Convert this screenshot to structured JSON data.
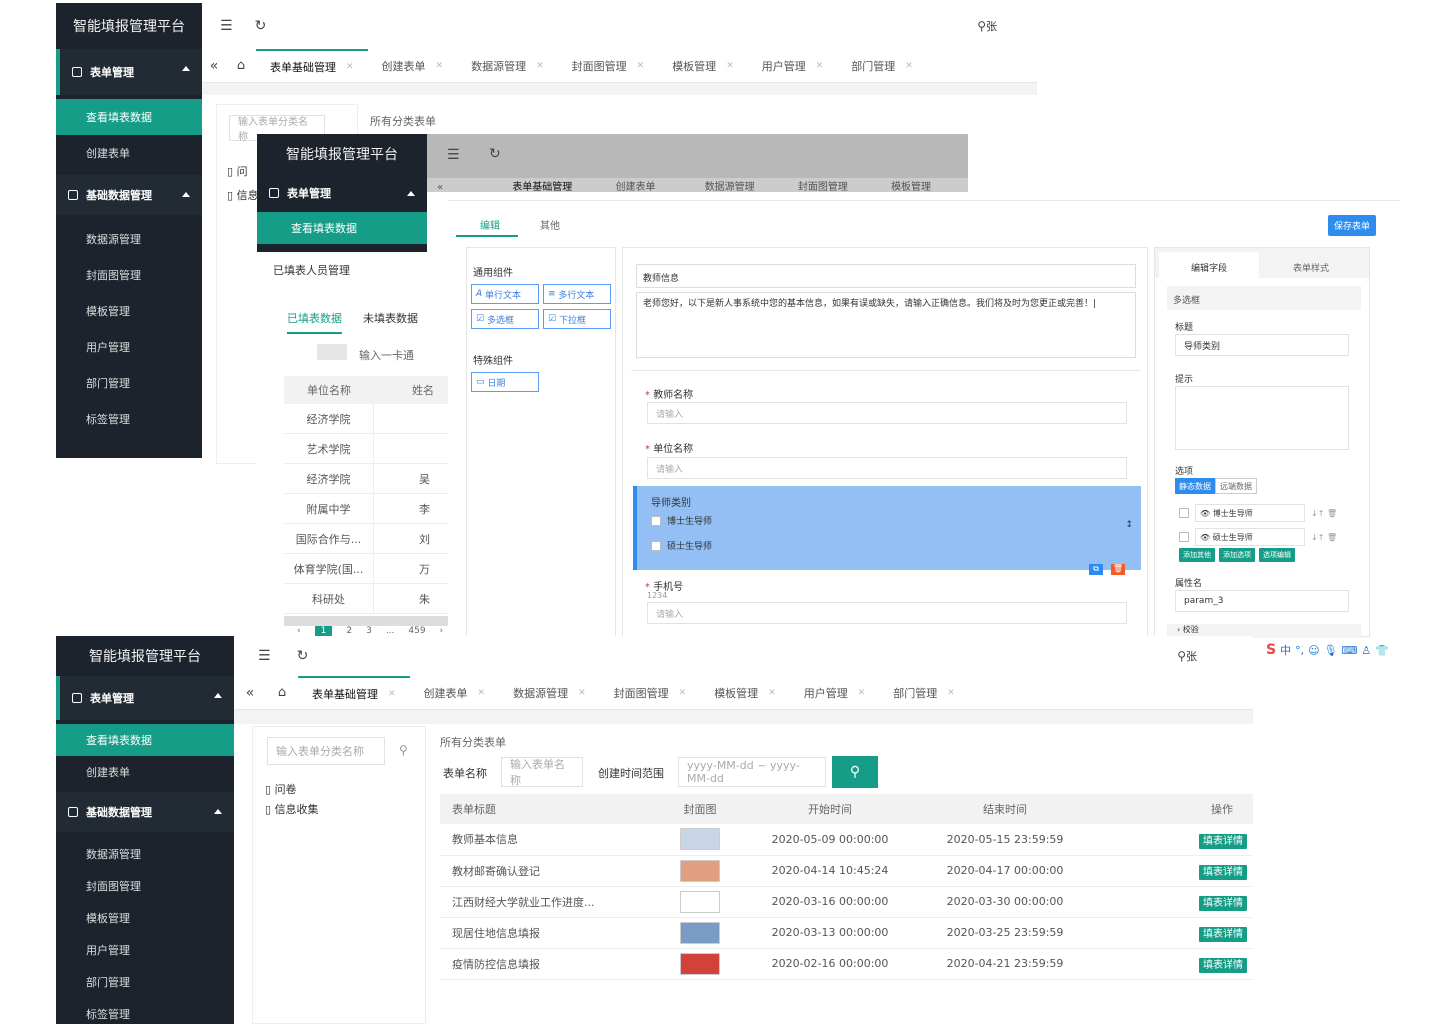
{
  "platform_title": "智能填报管理平台",
  "user_name": "张",
  "sidebar": {
    "group_form": "表单管理",
    "items_form": [
      "查看填表数据",
      "创建表单"
    ],
    "group_base": "基础数据管理",
    "items_base": [
      "数据源管理",
      "封面图管理",
      "模板管理",
      "用户管理",
      "部门管理",
      "标签管理"
    ]
  },
  "tabs": [
    {
      "label": "表单基础管理"
    },
    {
      "label": "创建表单"
    },
    {
      "label": "数据源管理"
    },
    {
      "label": "封面图管理"
    },
    {
      "label": "模板管理"
    },
    {
      "label": "用户管理"
    },
    {
      "label": "部门管理"
    }
  ],
  "tree": {
    "search_placeholder": "输入表单分类名称",
    "nodes": [
      "问卷",
      "信息收集"
    ],
    "truncated_nodes": [
      "问",
      "信息"
    ]
  },
  "main": {
    "section_title": "所有分类表单",
    "form_name_label": "表单名称",
    "form_name_placeholder": "输入表单名称",
    "date_range_label": "创建时间范围",
    "date_range_placeholder": "yyyy-MM-dd ~ yyyy-MM-dd",
    "columns": [
      "表单标题",
      "封面图",
      "开始时间",
      "结束时间",
      "操作"
    ],
    "rows": [
      {
        "title": "教师基本信息",
        "start": "2020-05-09 00:00:00",
        "end": "2020-05-15 23:59:59",
        "action": "填表详情"
      },
      {
        "title": "教材邮寄确认登记",
        "start": "2020-04-14 10:45:24",
        "end": "2020-04-17 00:00:00",
        "action": "填表详情"
      },
      {
        "title": "江西财经大学就业工作进度...",
        "start": "2020-03-16 00:00:00",
        "end": "2020-03-30 00:00:00",
        "action": "填表详情"
      },
      {
        "title": "现居住地信息填报",
        "start": "2020-03-13 00:00:00",
        "end": "2020-03-25 23:59:59",
        "action": "填表详情"
      },
      {
        "title": "疫情防控信息填报",
        "start": "2020-02-16 00:00:00",
        "end": "2020-04-21 23:59:59",
        "action": "填表详情"
      }
    ]
  },
  "mid": {
    "sub_item": "已填表人员管理",
    "tab_filled": "已填表数据",
    "tab_unfilled": "未填表数据",
    "search_placeholder": "输入一卡通",
    "col_unit": "单位名称",
    "col_name": "姓名",
    "units": [
      "经济学院",
      "艺术学院",
      "经济学院",
      "附属中学",
      "国际合作与...",
      "体育学院(国...",
      "科研处"
    ],
    "names": [
      "",
      "",
      "吴",
      "李",
      "刘",
      "万",
      "朱"
    ],
    "pager": [
      "1",
      "2",
      "3",
      "...",
      "459"
    ],
    "tab_labels": [
      "表单基础管理",
      "创建表单",
      "数据源管理",
      "封面图管理",
      "模板管理"
    ]
  },
  "editor": {
    "tab_edit": "编辑",
    "tab_other": "其他",
    "save": "保存表单",
    "common_title": "通用组件",
    "comps": [
      "单行文本",
      "多行文本",
      "多选框",
      "下拉框"
    ],
    "special_title": "特殊组件",
    "special": [
      "日期"
    ],
    "info_title": "教师信息",
    "info_text": "老师您好，以下是新人事系统中您的基本信息，如果有误或缺失，请输入正确信息。我们将及时为您更正或完善！|",
    "f1": "教师名称",
    "f2": "单位名称",
    "placeholder": "请输入",
    "f3": "导师类别",
    "opt1": "博士生导师",
    "opt2": "硕士生导师",
    "f4": "手机号",
    "f4_hint": "1234",
    "rp_tab1": "编辑字段",
    "rp_tab2": "表单样式",
    "rp_type": "多选框",
    "rp_title": "标题",
    "rp_title_val": "导师类别",
    "rp_hint": "提示",
    "rp_opts": "选项",
    "rp_static": "静态数据",
    "rp_remote": "远端数据",
    "rp_opt_vals": [
      "博士生导师",
      "硕士生导师"
    ],
    "rp_btns": [
      "添加其他",
      "添加选项",
      "选项编辑"
    ],
    "rp_attr": "属性名",
    "rp_attr_val": "param_3",
    "rp_check": "校验"
  },
  "ime": "中"
}
